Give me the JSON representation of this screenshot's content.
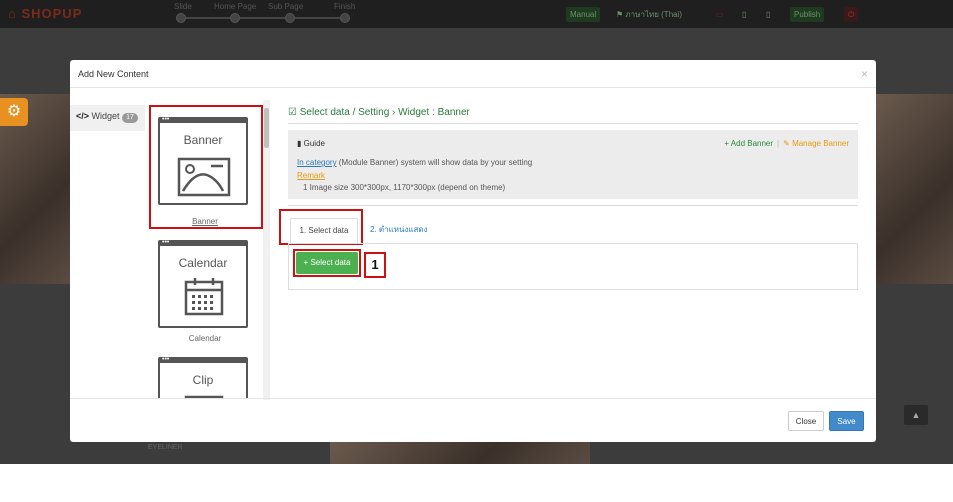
{
  "topbar": {
    "logo": "SHOPUP",
    "steps": [
      "Slide",
      "Home Page",
      "Sub Page",
      "Finish"
    ],
    "manual": "Manual",
    "language": "ภาษาไทย (Thai)",
    "publish": "Publish"
  },
  "modal": {
    "title": "Add New Content",
    "close_icon": "×"
  },
  "widget_tab": {
    "label": "Widget",
    "count": "17"
  },
  "cards": [
    {
      "title": "Banner",
      "label": "Banner"
    },
    {
      "title": "Calendar",
      "label": "Calendar"
    },
    {
      "title": "Clip",
      "label": ""
    }
  ],
  "content": {
    "breadcrumb": "Select data / Setting › Widget : Banner",
    "guide": {
      "heading": "Guide",
      "line1_link": "In category",
      "line1_rest": " (Module Banner) system will show data by your setting",
      "remark": "Remark",
      "line3": "1 Image size 300*300px, 1170*300px (depend on theme)",
      "add_banner": "Add Banner",
      "manage_banner": "Manage Banner"
    },
    "tabs": [
      "1. Select data",
      "2. ตำแหน่งแสดง"
    ],
    "select_button": "Select data",
    "callout": "1"
  },
  "footer": {
    "close": "Close",
    "save": "Save"
  },
  "bottom_text": "EYELINER",
  "colors": {
    "accent_green": "#4caf50",
    "highlight_red": "#cc1111",
    "save_blue": "#428bca"
  }
}
